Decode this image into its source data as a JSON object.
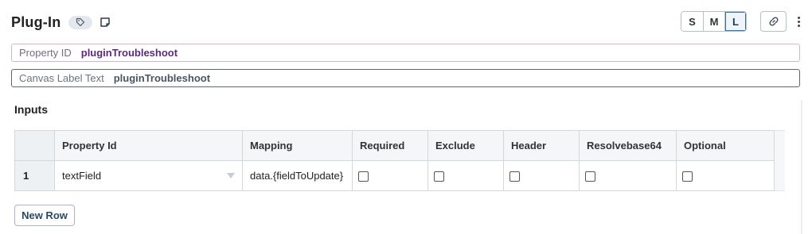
{
  "header": {
    "title": "Plug-In",
    "tag_icon": "tag-icon",
    "note_icon": "note-icon",
    "size_options": [
      "S",
      "M",
      "L"
    ],
    "size_selected": "L",
    "link_icon": "link-icon",
    "more_icon": "more-vertical-icon"
  },
  "property_id": {
    "label": "Property ID",
    "value": "pluginTroubleshoot"
  },
  "canvas_label": {
    "label": "Canvas Label Text",
    "value": "pluginTroubleshoot"
  },
  "inputs": {
    "title": "Inputs",
    "columns": [
      "",
      "Property Id",
      "Mapping",
      "Required",
      "Exclude",
      "Header",
      "Resolvebase64",
      "Optional"
    ],
    "rows": [
      {
        "index": "1",
        "property_id": "textField",
        "mapping": "data.{fieldToUpdate}",
        "required": false,
        "exclude": false,
        "header": false,
        "resolvebase64": false,
        "optional": false
      }
    ],
    "new_row_label": "New Row"
  },
  "colors": {
    "property_value": "#5b2a7a",
    "active_size_border": "#3f6f8f"
  }
}
